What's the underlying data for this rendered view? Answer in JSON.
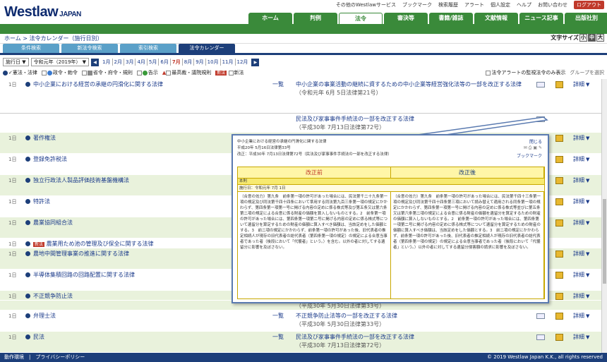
{
  "header": {
    "logo": "Westlaw",
    "logo_sub": "JAPAN",
    "top_links": [
      "その他のWestlawサービス",
      "ブックマーク",
      "検索履歴",
      "アラート",
      "個人設定",
      "ヘルプ",
      "お問い合わせ"
    ],
    "logout": "ログアウト",
    "nav": [
      "ホーム",
      "判例",
      "法令",
      "審決等",
      "書籍/雑誌",
      "文献情報",
      "ニュース記事",
      "出版社別"
    ],
    "nav_active": 2
  },
  "breadcrumb": {
    "home": "ホーム",
    "sep": " > ",
    "current": "法令カレンダー（施行日別）"
  },
  "font_size": {
    "label": "文字サイズ",
    "small": "小",
    "mid": "中",
    "large": "大"
  },
  "subtabs": [
    "条件検索",
    "新法令検索",
    "索引検索",
    "法令カレンダー"
  ],
  "controls": {
    "select1": "施行日",
    "select2": "令和元年（2019年）",
    "months": [
      "1月",
      "2月",
      "3月",
      "4月",
      "5月",
      "6月",
      "7月",
      "8月",
      "9月",
      "10月",
      "11月",
      "12月"
    ],
    "current_month": 6
  },
  "filters": {
    "f1": "憲法・法律",
    "f2": "政令・勅令",
    "f3": "省令・府令・規則",
    "f4": "告示",
    "f5": "最高裁・議院規則",
    "new_badge": "新法",
    "f6": "新法",
    "alert_label": "法令アラートの監視法令のみ表示",
    "group_label": "グループを選択"
  },
  "rows": [
    {
      "day": "1日",
      "title": "中小企業における経営の承継の円滑化に関する法律",
      "type": "一覧",
      "law": "中小企業の事業活動の継続に資するための中小企業等経営強化法等の一部を改正する法律",
      "sub": "（令和元年 6月 5日法律第21号）"
    },
    {
      "day": "",
      "title": "",
      "type": "",
      "law": "民法及び家事事件手続法の一部を改正する法律",
      "sub": "（平成30年 7月13日法律第72号）"
    },
    {
      "day": "1日",
      "title": "著作権法",
      "type": "",
      "law": "",
      "sub": ""
    },
    {
      "day": "1日",
      "title": "登録免許税法",
      "type": "",
      "law": "",
      "sub": ""
    },
    {
      "day": "1日",
      "title": "独立行政法人製品評価技術基盤機構法",
      "type": "",
      "law": "",
      "sub": ""
    },
    {
      "day": "1日",
      "title": "特許法",
      "type": "",
      "law": "",
      "sub": ""
    },
    {
      "day": "1日",
      "title": "農業協同組合法",
      "type": "",
      "law": "",
      "sub": ""
    },
    {
      "day": "1日",
      "title": "農業用ため池の管理及び保全に関する法律",
      "type": "",
      "law": "",
      "sub": "",
      "badge": "新法"
    },
    {
      "day": "1日",
      "title": "農地中間管理事業の推進に関する法律",
      "type": "",
      "law": "",
      "sub": ""
    },
    {
      "day": "1日",
      "title": "半導体集積回路の回路配置に関する法律",
      "type": "",
      "law": "",
      "sub": ""
    },
    {
      "day": "1日",
      "title": "不正競争防止法",
      "type": "",
      "law": "",
      "sub": ""
    },
    {
      "day": "",
      "title": "",
      "type": "",
      "law": "",
      "sub": "（平成30年 5月30日法律第33号）"
    },
    {
      "day": "1日",
      "title": "弁理士法",
      "type": "一覧",
      "law": "不正競争防止法等の一部を改正する法律",
      "sub": "（平成30年 5月30日法律第33号）"
    },
    {
      "day": "1日",
      "title": "民法",
      "type": "一覧",
      "law": "民法及び家事事件手続法の一部を改正する法律",
      "sub": "（平成30年 7月13日法律第72号）"
    }
  ],
  "detail_label": "詳細",
  "popup": {
    "line1": "中小企業における経営の承継の円滑化に関する法律",
    "line2": "平成20年 5月16日法律第33号",
    "line3": "改正：平成30年 7月13日法律第72号（民法及び家事事件手続法の一部を改正する法律）",
    "close": "閉じる",
    "bookmark": "ブックマーク",
    "before": "改正前",
    "after": "改正後",
    "article": "本則",
    "effective": "施行日：令和元年 7月 1日",
    "left_text": "（合意の効力）第九条　前条第一項の許可があった場合には、民法第千二十九条第一項の規定及び同法第千四十四条において準用する同法第九百三条第一項の規定にかかわらず、第四条第一項第一号に掲げる内容の定めに係る株式等及び第五条又は第六条第二項の規定による合意に係る財産の価額を算入しないものとする。2　前条第一項の許可があった場合には、第四条第一項第二号に掲げる内容の定めに係る株式等について遺留分を算定するための財産の価額に算入すべき価額は、当該定めをした価額とする。3　前二項の規定にかかわらず、前条第一項の許可があった後、旧代表者の推定相続人が現存の旧代表者の総代表者（第四条第一項の規定）の規定による合意当事者であった者（後段において「代襲者」という。）を含む。以外の者に対してする遺留分に影響を及ぼさない。",
    "right_text": "（合意の効力）第九条　前条第一項の許可があった場合には、民法第千四十三条第一項の規定及び同法第千四十四条第三項において読み替えて適用される同条第一項の規定にかかわらず、第四条第一項第一号に掲げる内容の定めに係る株式等並びに第五条又は第六条第二項の規定による合意に係る財産の価額を遺留分を算定するための財産の価額に算入しないものとする。2　前条第一項の許可があった場合には、第四条第一項第二号に掲げる内容の定めに係る株式等について遺留分を算定するための財産の価額に算入すべき価額は、当該定めをした価額とする。3　前二項の規定にかかわらず、前条第一項の許可があった後、旧代表者の推定相続人が現存の旧代表者の総代表者（第四条第一項の規定）の規定による合意当事者であった者（後段において「代襲者」という。）以外の者に対してする遺留分侵害額の請求に影響を及ぼさない。"
  },
  "footer": {
    "left": [
      "動作環境",
      "プライバシーポリシー"
    ],
    "right": "© 2019 Westlaw Japan K.K., all rights reserved"
  }
}
